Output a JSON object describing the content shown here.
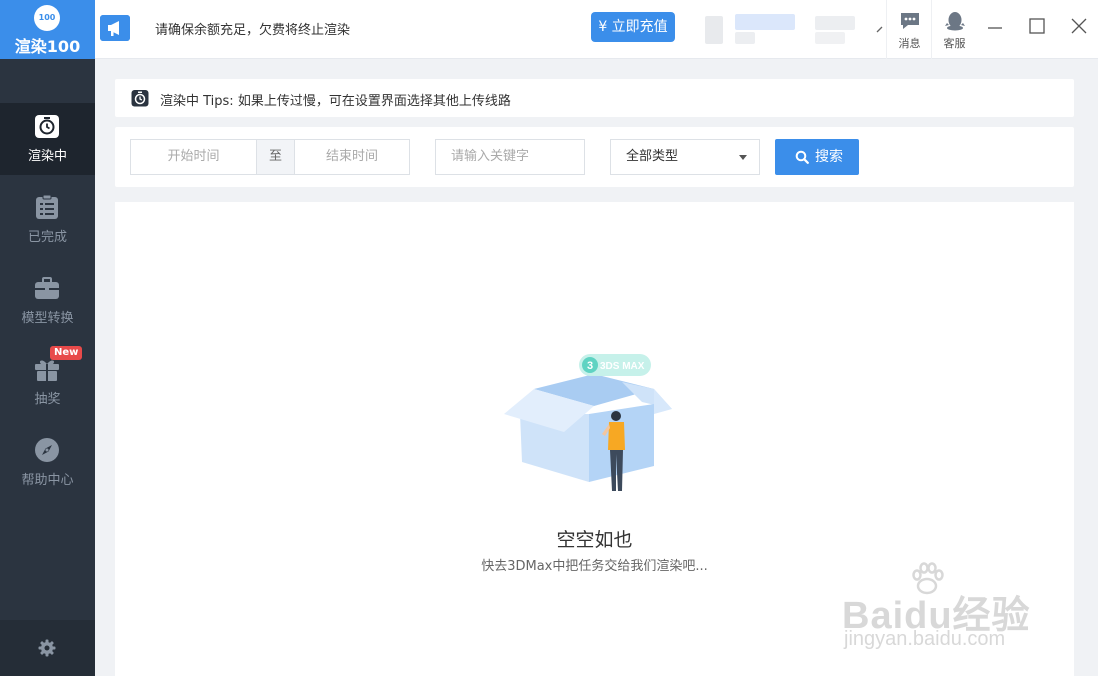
{
  "app": {
    "logo_badge": "100",
    "logo_name": "渲染100"
  },
  "sidebar": {
    "items": [
      {
        "label": "渲染中",
        "icon": "clock-icon",
        "active": true
      },
      {
        "label": "已完成",
        "icon": "clipboard-icon"
      },
      {
        "label": "模型转换",
        "icon": "briefcase-icon"
      },
      {
        "label": "抽奖",
        "icon": "gift-icon",
        "badge": "New"
      },
      {
        "label": "帮助中心",
        "icon": "compass-icon"
      }
    ],
    "settings_icon": "gear-icon"
  },
  "topbar": {
    "notice": "请确保余额充足，欠费将终止渲染",
    "recharge_label": "¥ 立即充值",
    "messages_label": "消息",
    "service_label": "客服"
  },
  "tips": {
    "text": "渲染中 Tips: 如果上传过慢，可在设置界面选择其他上传线路"
  },
  "filter": {
    "start_placeholder": "开始时间",
    "separator": "至",
    "end_placeholder": "结束时间",
    "keyword_placeholder": "请输入关键字",
    "type_selected": "全部类型",
    "search_label": "搜索"
  },
  "empty": {
    "badge": "3DS MAX",
    "title": "空空如也",
    "subtitle": "快去3DMax中把任务交给我们渲染吧..."
  },
  "watermark": {
    "brand": "Baidu经验",
    "url": "jingyan.baidu.com"
  },
  "colors": {
    "accent": "#3b8eea",
    "sidebar": "#2b3440",
    "badge": "#e84a4a",
    "teal": "#5fd3c2"
  }
}
